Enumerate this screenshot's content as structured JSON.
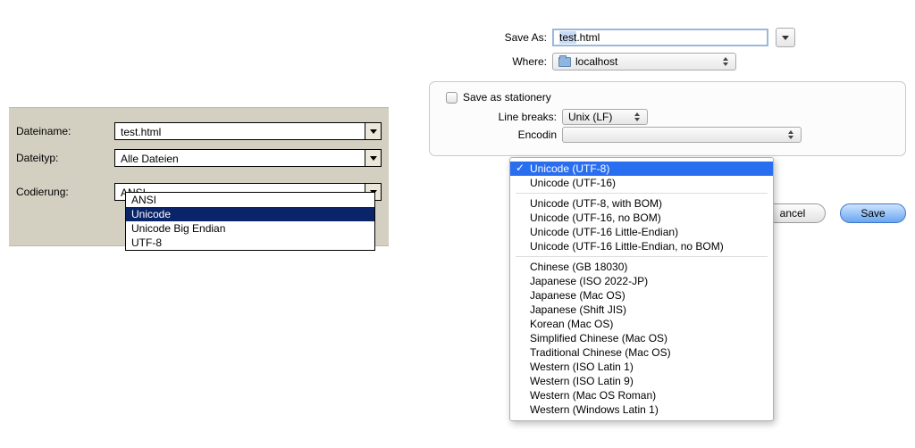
{
  "win": {
    "labels": {
      "filename": "Dateiname:",
      "filetype": "Dateityp:",
      "encoding": "Codierung:"
    },
    "filename_value": "test.html",
    "filetype_value": "Alle Dateien",
    "encoding_value": "ANSI",
    "encoding_options": [
      "ANSI",
      "Unicode",
      "Unicode Big Endian",
      "UTF-8"
    ],
    "encoding_selected_index": 1
  },
  "mac": {
    "labels": {
      "save_as": "Save As:",
      "where": "Where:",
      "line_breaks": "Line breaks:",
      "encoding": "Encodin"
    },
    "save_as_value": "test.html",
    "save_as_sel": "test",
    "save_as_rest": ".html",
    "where_value": "localhost",
    "stationery_label": "Save as stationery",
    "stationery_checked": false,
    "line_breaks_value": "Unix (LF)",
    "encoding_value": "Unicode (UTF-8)",
    "encoding_groups": [
      [
        "Unicode (UTF-8)",
        "Unicode (UTF-16)"
      ],
      [
        "Unicode (UTF-8, with BOM)",
        "Unicode (UTF-16, no BOM)",
        "Unicode (UTF-16 Little-Endian)",
        "Unicode (UTF-16 Little-Endian, no BOM)"
      ],
      [
        "Chinese (GB 18030)",
        "Japanese (ISO 2022-JP)",
        "Japanese (Mac OS)",
        "Japanese (Shift JIS)",
        "Korean (Mac OS)",
        "Simplified Chinese (Mac OS)",
        "Traditional Chinese (Mac OS)",
        "Western (ISO Latin 1)",
        "Western (ISO Latin 9)",
        "Western (Mac OS Roman)",
        "Western (Windows Latin 1)"
      ]
    ],
    "encoding_selected": "Unicode (UTF-8)",
    "buttons": {
      "cancel": "ancel",
      "save": "Save"
    }
  }
}
